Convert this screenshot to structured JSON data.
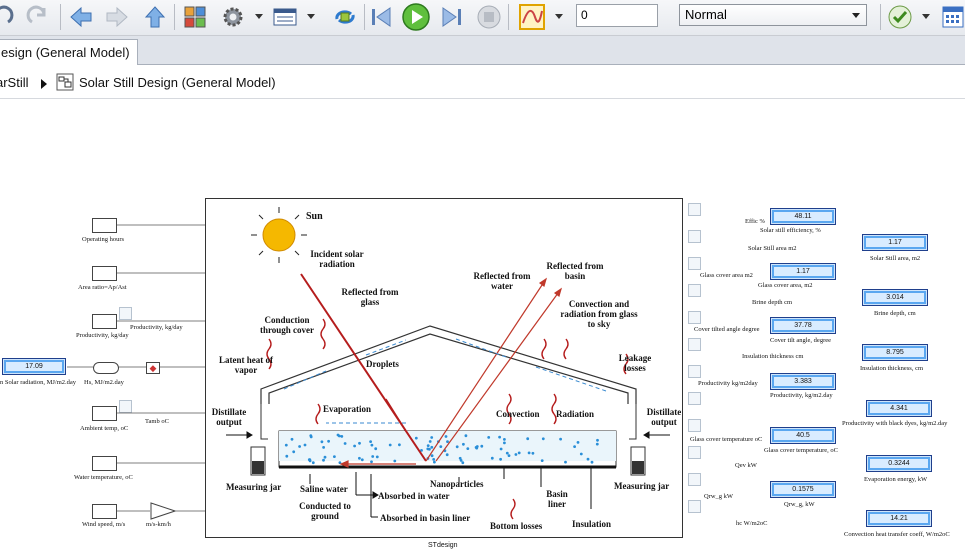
{
  "toolbar": {
    "time_value": "0",
    "mode_value": "Normal",
    "icons": [
      "undo-icon",
      "redo-icon",
      "back-arrow-icon",
      "forward-arrow-icon",
      "up-arrow-icon",
      "model-palette-icon",
      "gear-icon",
      "table-icon",
      "loop-icon",
      "step-back-icon",
      "run-icon",
      "step-forward-icon",
      "stop-icon",
      "graph-icon",
      "check-icon",
      "calendar-icon"
    ]
  },
  "tab": {
    "label": "esign (General Model)"
  },
  "breadcrumb": {
    "parent": "arStill",
    "current": "Solar Still Design (General Model)"
  },
  "diagram": {
    "caption": "STdesign",
    "labels": {
      "sun": "Sun",
      "incident": "Incident solar radiation",
      "reflected_glass": "Reflected from glass",
      "reflected_water": "Reflected from water",
      "reflected_basin": "Reflected from basin",
      "conduction_cover": "Conduction through cover",
      "conv_rad_glass": "Convection and radiation from glass to sky",
      "droplets": "Droplets",
      "latent": "Latent heat of vapor",
      "leakage": "Leakage losses",
      "evaporation": "Evaporation",
      "convection": "Convection",
      "radiation": "Radiation",
      "distillate_left": "Distillate output",
      "distillate_right": "Distillate output",
      "measuring_left": "Measuring jar",
      "measuring_right": "Measuring jar",
      "saline": "Saline water",
      "nanoparticles": "Nanoparticles",
      "absorbed_water": "Absorbed in water",
      "absorbed_liner": "Absorbed in basin liner",
      "conducted_ground": "Conducted to ground",
      "basin_liner": "Basin liner",
      "bottom_losses": "Bottom losses",
      "insulation": "Insulation"
    }
  },
  "inputs": [
    {
      "label": "Operating hours"
    },
    {
      "label": "Area ratio=Ap/Ast"
    },
    {
      "label": "Productivity, kg/day"
    },
    {
      "label": "Ambient temp, oC"
    },
    {
      "label": "Water temperature, oC"
    },
    {
      "label": "Wind speed, m/s"
    }
  ],
  "left_extra": {
    "solar_value": "17.09",
    "solar_label": "n Solar radiation, MJ/m2.day",
    "hs_label": "Hs, MJ/m2.day",
    "prod_label": "Productivity, kg/day",
    "tamb_label": "Tamb oC",
    "converter_label": "m/s-km/h"
  },
  "outputs": [
    {
      "small": "Effic %",
      "label": "Solar still efficiency, %",
      "value": "48.11"
    },
    {
      "small": "Solar Still area m2",
      "label": "Solar Still area, m2",
      "value": "1.17"
    },
    {
      "small": "Glass cover area m2",
      "label": "Glass cover area, m2",
      "value": "1.17"
    },
    {
      "small": "Brine depth cm",
      "label": "Brine depth, cm",
      "value": "3.014"
    },
    {
      "small": "Cover tilted angle degree",
      "label": "Cover tilt angle, degree",
      "value": "37.78"
    },
    {
      "small": "Insulation thickness cm",
      "label": "Insulation thickness, cm",
      "value": "8.795"
    },
    {
      "small": "Productivity kg/m2day",
      "label": "Productivity, kg/m2.day",
      "value": "3.383"
    },
    {
      "small": "",
      "label": "Productivity with black dyes, kg/m2.day",
      "value": "4.341"
    },
    {
      "small": "Glass cover temperature oC",
      "label": "Glass cover temperature, oC",
      "value": "40.5"
    },
    {
      "small": "Qev kW",
      "label": "Evaporation energy, kW",
      "value": "0.3244"
    },
    {
      "small": "Qrw_g kW",
      "label": "Qrw_g, kW",
      "value": "0.1575"
    },
    {
      "small": "hc W/m2oC",
      "label": "Convection heat transfer coeff, W/m2oC",
      "value": "14.21"
    }
  ]
}
